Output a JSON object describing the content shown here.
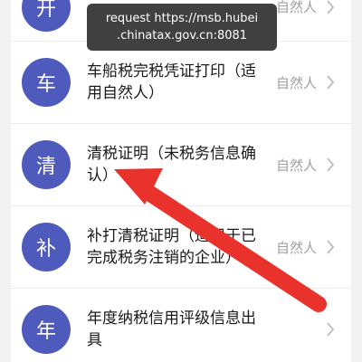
{
  "toast": {
    "line1": "request https://msb.hubei",
    "line2": ".chinatax.gov.cn:8081"
  },
  "rows": [
    {
      "badge": "开",
      "title": "",
      "tag": "自然人"
    },
    {
      "badge": "车",
      "title": "车船税完税凭证打印（适用自然人）",
      "tag": "自然人"
    },
    {
      "badge": "清",
      "title": "清税证明（未税务信息确认）",
      "tag": "自然人"
    },
    {
      "badge": "补",
      "title": "补打清税证明（适用于已完成税务注销的企业）",
      "tag": "自然人"
    },
    {
      "badge": "年",
      "title": "年度纳税信用评级信息出具",
      "tag": ""
    }
  ],
  "colors": {
    "badge": "#4e5abc",
    "arrow": "#e8322b",
    "toast_bg": "#303030"
  },
  "icons": {
    "chevron": "chevron-right-icon",
    "annotation": "red-arrow-icon"
  }
}
